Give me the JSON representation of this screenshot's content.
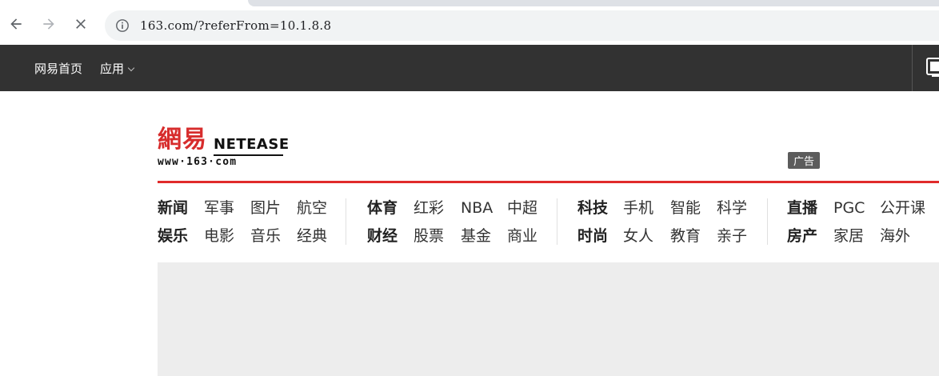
{
  "browser": {
    "url": "163.com/?referFrom=10.1.8.8",
    "icons": {
      "back": "arrow-left-icon",
      "forward": "arrow-right-icon",
      "stop": "close-icon",
      "info": "info-icon"
    }
  },
  "topbar": {
    "home_label": "网易首页",
    "apps_label": "应用"
  },
  "logo": {
    "cn": "網易",
    "en": "NETEASE",
    "domain": "www·163·com"
  },
  "ad_label": "广告",
  "nav": {
    "groups": [
      {
        "rows": [
          {
            "head": "新闻",
            "items": [
              "军事",
              "图片",
              "航空"
            ]
          },
          {
            "head": "娱乐",
            "items": [
              "电影",
              "音乐",
              "经典"
            ]
          }
        ]
      },
      {
        "rows": [
          {
            "head": "体育",
            "items": [
              "红彩",
              "NBA",
              "中超"
            ]
          },
          {
            "head": "财经",
            "items": [
              "股票",
              "基金",
              "商业"
            ]
          }
        ]
      },
      {
        "rows": [
          {
            "head": "科技",
            "items": [
              "手机",
              "智能",
              "科学"
            ]
          },
          {
            "head": "时尚",
            "items": [
              "女人",
              "教育",
              "亲子"
            ]
          }
        ]
      },
      {
        "rows": [
          {
            "head": "直播",
            "items": [
              "PGC",
              "公开课"
            ]
          },
          {
            "head": "房产",
            "items": [
              "家居",
              "海外"
            ]
          }
        ]
      }
    ]
  },
  "colors": {
    "topbar_bg": "#323232",
    "brand_red": "#e02b2b",
    "omnibox_bg": "#f1f3f4",
    "banner_bg": "#ededed"
  }
}
